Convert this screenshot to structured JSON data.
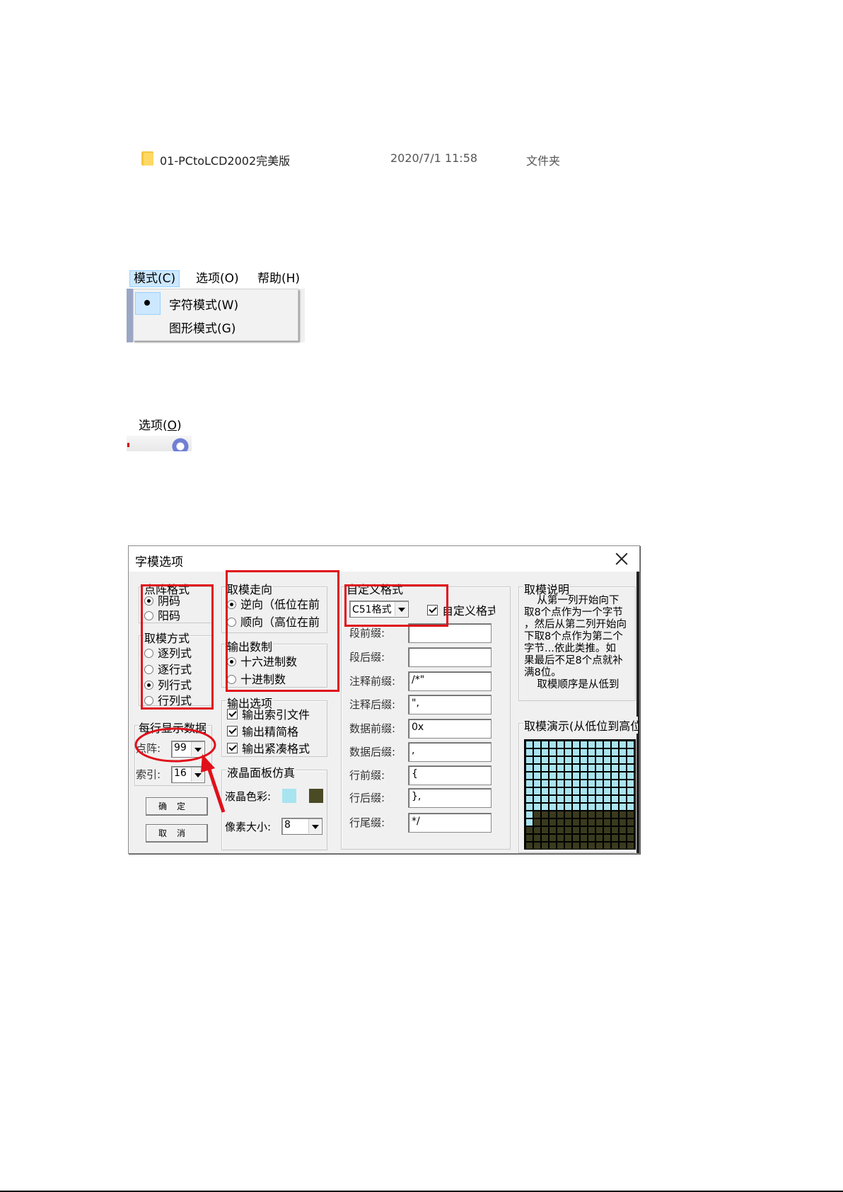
{
  "file_row": {
    "name": "01-PCtoLCD2002完美版",
    "date": "2020/7/1 11:58",
    "type": "文件夹"
  },
  "mode_menu": {
    "menubar": [
      "模式(C)",
      "选项(O)",
      "帮助(H)"
    ],
    "items": [
      {
        "label": "字符模式(W)",
        "selected": true
      },
      {
        "label": "图形模式(G)",
        "selected": false
      }
    ]
  },
  "options_menu": {
    "label_prefix": "选项(",
    "label_key": "O",
    "label_suffix": ")"
  },
  "dialog": {
    "title": "字模选项",
    "dot_format": {
      "legend": "点阵格式",
      "options": [
        {
          "label": "阴码",
          "selected": true
        },
        {
          "label": "阳码",
          "selected": false
        }
      ]
    },
    "mode": {
      "legend": "取模方式",
      "options": [
        {
          "label": "逐列式",
          "selected": false
        },
        {
          "label": "逐行式",
          "selected": false
        },
        {
          "label": "列行式",
          "selected": true
        },
        {
          "label": "行列式",
          "selected": false
        }
      ]
    },
    "per_line": {
      "legend": "每行显示数据",
      "dot_label": "点阵:",
      "dot_value": "99",
      "index_label": "索引:",
      "index_value": "16"
    },
    "buttons": {
      "ok": "确定",
      "cancel": "取消"
    },
    "direction": {
      "legend": "取模走向",
      "options": [
        {
          "label": "逆向（低位在前",
          "selected": true
        },
        {
          "label": "顺向（高位在前",
          "selected": false
        }
      ]
    },
    "number_base": {
      "legend": "输出数制",
      "options": [
        {
          "label": "十六进制数",
          "selected": true
        },
        {
          "label": "十进制数",
          "selected": false
        }
      ]
    },
    "output_options": {
      "legend": "输出选项",
      "items": [
        {
          "label": "输出索引文件",
          "checked": true
        },
        {
          "label": "输出精简格",
          "checked": true
        },
        {
          "label": "输出紧凑格式",
          "checked": true
        }
      ]
    },
    "lcd_sim": {
      "legend": "液晶面板仿真",
      "color_label": "液晶色彩:",
      "color_light": "#a8e4f0",
      "color_dark": "#4a4a24",
      "pixel_label": "像素大小:",
      "pixel_value": "8"
    },
    "custom_format": {
      "legend": "自定义格式",
      "format_value": "C51格式",
      "custom_checkbox_label": "自定义格式",
      "custom_checked": true,
      "fields": [
        {
          "label": "段前缀:",
          "value": ""
        },
        {
          "label": "段后缀:",
          "value": ""
        },
        {
          "label": "注释前缀:",
          "value": "/*\""
        },
        {
          "label": "注释后缀:",
          "value": "\","
        },
        {
          "label": "数据前缀:",
          "value": "0x"
        },
        {
          "label": "数据后缀:",
          "value": ","
        },
        {
          "label": "行前缀:",
          "value": "{"
        },
        {
          "label": "行后缀:",
          "value": "},"
        },
        {
          "label": "行尾缀:",
          "value": "*/"
        }
      ]
    },
    "explanation": {
      "legend": "取模说明",
      "text": "    从第一列开始向下\n取8个点作为一个字节\n，然后从第二列开始向\n下取8个点作为第二个\n字节...依此类推。如\n果最后不足8个点就补\n满8位。\n    取模顺序是从低到"
    },
    "demo": {
      "legend": "取模演示(从低位到高位)"
    }
  },
  "colors": {
    "highlight_red": "#e0101a",
    "lcd_light": "#a8e4f0",
    "lcd_dark": "#3a3a1e"
  }
}
